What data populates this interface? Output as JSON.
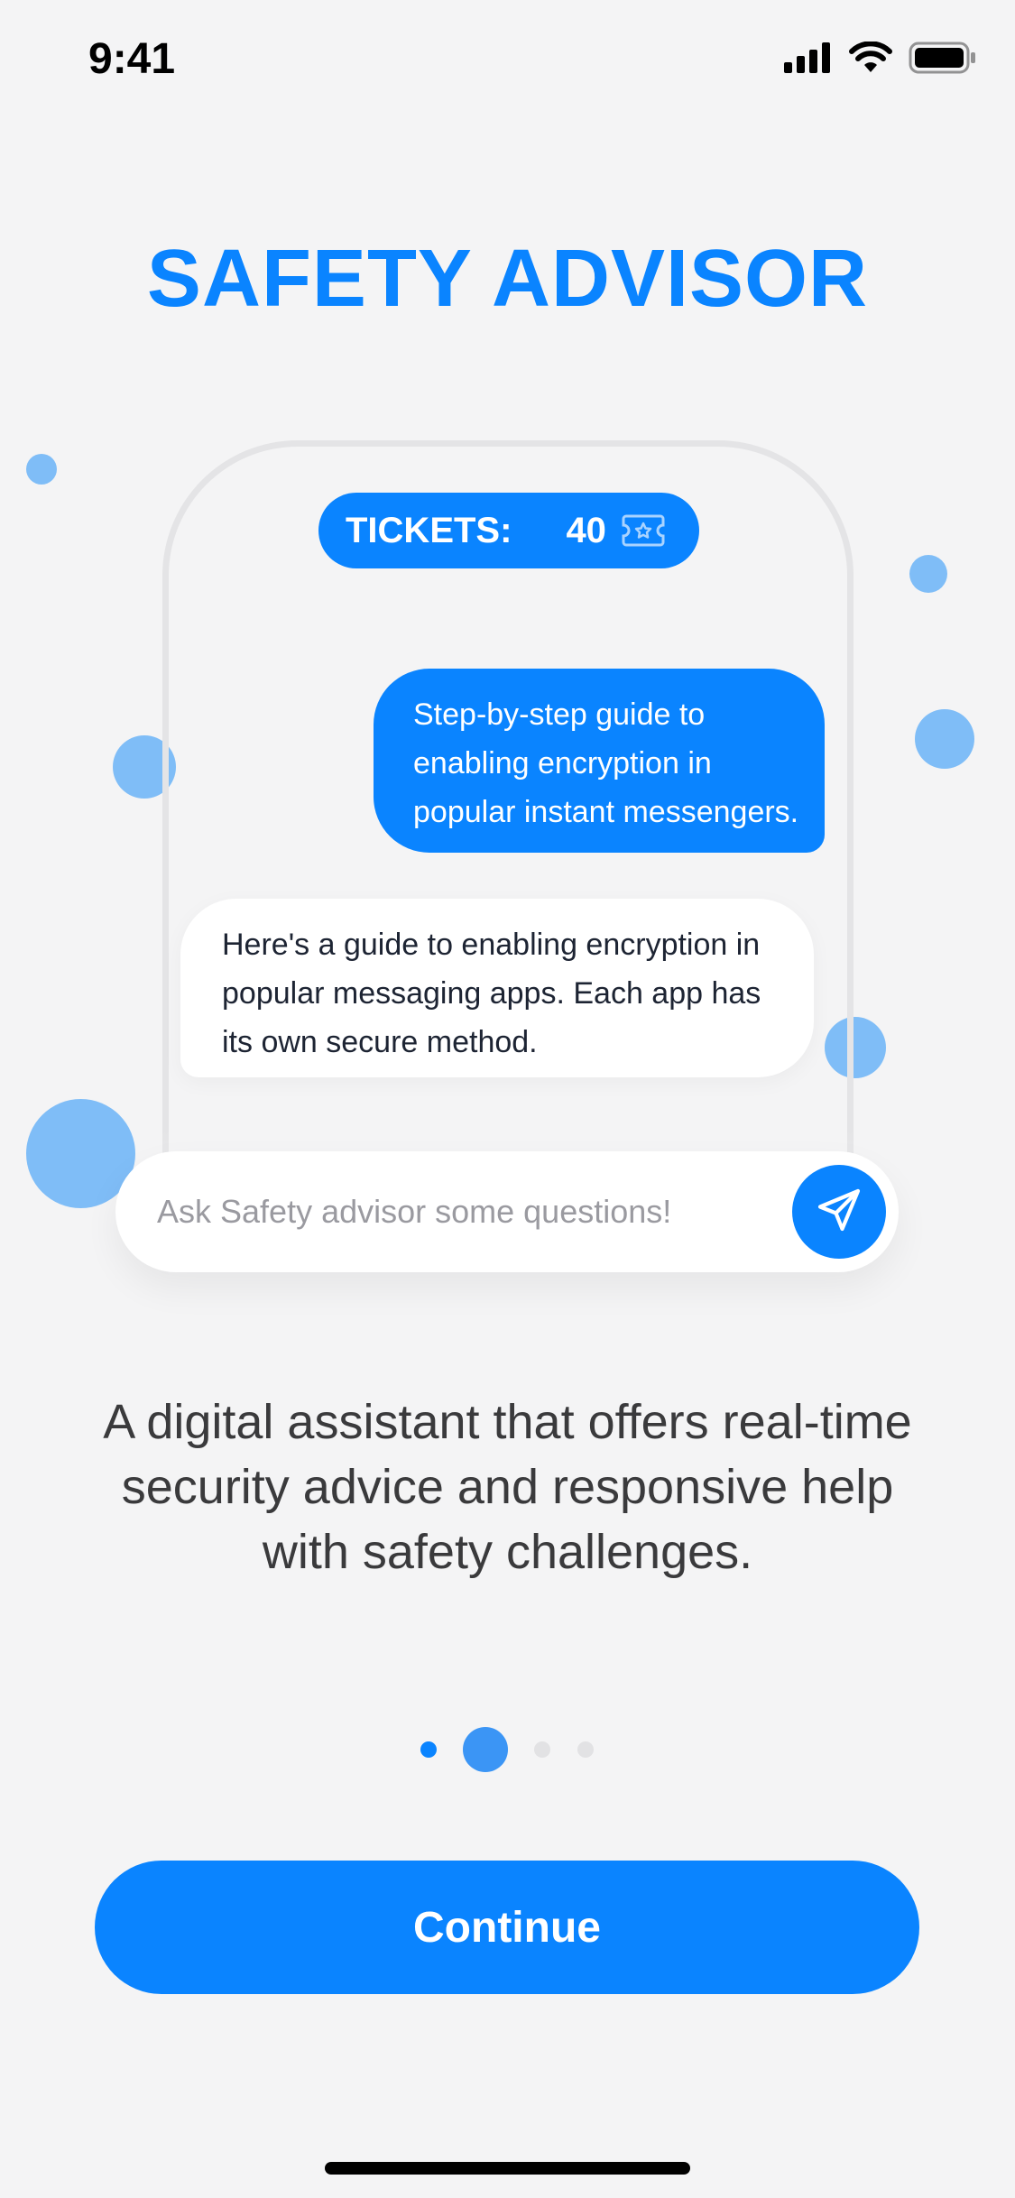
{
  "status_bar": {
    "time": "9:41"
  },
  "title": "SAFETY ADVISOR",
  "tickets": {
    "label": "TICKETS:",
    "count": "40"
  },
  "chat": {
    "user_message_lines": [
      "Step-by-step guide to",
      "enabling encryption in",
      "popular instant messengers."
    ],
    "bot_message_lines": [
      "Here's a guide to enabling encryption in",
      "popular messaging apps. Each app has",
      "its own secure method."
    ]
  },
  "ask_input": {
    "placeholder": "Ask Safety advisor some questions!"
  },
  "description_lines": [
    "A digital assistant that offers real-time",
    "security advice and responsive help",
    "with safety challenges."
  ],
  "pager": {
    "total": 4,
    "active_index": 1
  },
  "continue_button": {
    "label": "Continue"
  },
  "colors": {
    "accent": "#0a84ff",
    "bubble_decor": "#7fbdf7",
    "background": "#f4f4f5"
  },
  "icons": [
    "signal-icon",
    "wifi-icon",
    "battery-icon",
    "ticket-icon",
    "send-icon"
  ]
}
